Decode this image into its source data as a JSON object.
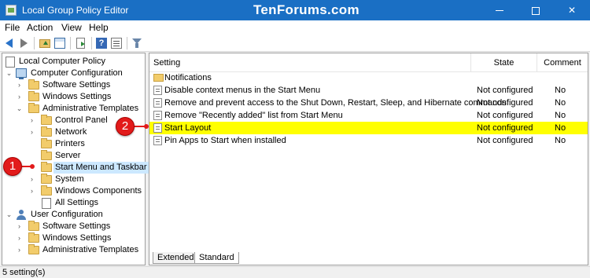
{
  "window": {
    "title": "Local Group Policy Editor",
    "watermark": "TenForums.com",
    "minimize_icon": "minimize-icon",
    "maximize_icon": "maximize-icon",
    "close_glyph": "✕"
  },
  "menu": {
    "items": [
      {
        "label": "File"
      },
      {
        "label": "Action"
      },
      {
        "label": "View"
      },
      {
        "label": "Help"
      }
    ]
  },
  "toolbar": {
    "icons": [
      "back-arrow-icon",
      "forward-arrow-icon",
      "up-folder-icon",
      "show-hide-tree-icon",
      "export-list-icon",
      "help-icon",
      "properties-icon",
      "filter-icon"
    ],
    "help_glyph": "?"
  },
  "tree": {
    "chevron_collapsed": "›",
    "chevron_expanded": "⌄",
    "items": [
      {
        "label": "Local Computer Policy"
      },
      {
        "label": "Computer Configuration"
      },
      {
        "label": "Software Settings"
      },
      {
        "label": "Windows Settings"
      },
      {
        "label": "Administrative Templates"
      },
      {
        "label": "Control Panel"
      },
      {
        "label": "Network"
      },
      {
        "label": "Printers"
      },
      {
        "label": "Server"
      },
      {
        "label": "Start Menu and Taskbar"
      },
      {
        "label": "System"
      },
      {
        "label": "Windows Components"
      },
      {
        "label": "All Settings"
      },
      {
        "label": "User Configuration"
      },
      {
        "label": "Software Settings"
      },
      {
        "label": "Windows Settings"
      },
      {
        "label": "Administrative Templates"
      }
    ]
  },
  "list": {
    "columns": {
      "setting": "Setting",
      "state": "State",
      "comment": "Comment"
    },
    "rows": [
      {
        "setting": "Notifications",
        "state": "",
        "comment": ""
      },
      {
        "setting": "Disable context menus in the Start Menu",
        "state": "Not configured",
        "comment": "No"
      },
      {
        "setting": "Remove and prevent access to the Shut Down, Restart, Sleep, and Hibernate commands",
        "state": "Not configured",
        "comment": "No"
      },
      {
        "setting": "Remove \"Recently added\" list from Start Menu",
        "state": "Not configured",
        "comment": "No"
      },
      {
        "setting": "Start Layout",
        "state": "Not configured",
        "comment": "No"
      },
      {
        "setting": "Pin Apps to Start when installed",
        "state": "Not configured",
        "comment": "No"
      }
    ],
    "highlight_color": "#ffff00"
  },
  "tabs": [
    {
      "label": "Extended"
    },
    {
      "label": "Standard"
    }
  ],
  "status": {
    "text": "5 setting(s)"
  },
  "callouts": [
    {
      "number": "1"
    },
    {
      "number": "2"
    }
  ],
  "colors": {
    "titlebar": "#1a6fc4",
    "callout": "#e21b1b",
    "selection": "#cce8ff"
  }
}
